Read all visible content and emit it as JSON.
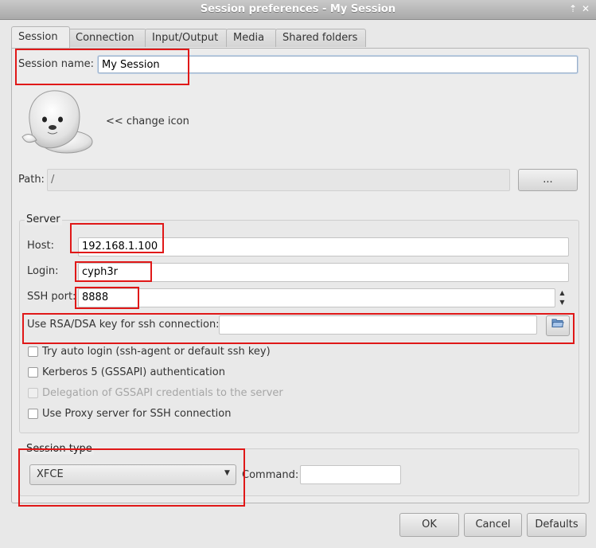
{
  "window": {
    "title": "Session preferences - My Session"
  },
  "tabs": [
    {
      "label": "Session"
    },
    {
      "label": "Connection"
    },
    {
      "label": "Input/Output"
    },
    {
      "label": "Media"
    },
    {
      "label": "Shared folders"
    }
  ],
  "session": {
    "name_label": "Session name:",
    "name_value": "My Session",
    "change_icon_label": "<< change icon",
    "path_label": "Path:",
    "path_value": "/",
    "browse_label": "..."
  },
  "server": {
    "group_title": "Server",
    "host_label": "Host:",
    "host_value": "192.168.1.100",
    "login_label": "Login:",
    "login_value": "cyph3r",
    "port_label": "SSH port:",
    "port_value": "8888",
    "rsa_label": "Use RSA/DSA key for ssh connection:",
    "rsa_value": "",
    "options": [
      {
        "label": "Try auto login (ssh-agent or default ssh key)",
        "checked": false,
        "enabled": true
      },
      {
        "label": "Kerberos 5 (GSSAPI) authentication",
        "checked": false,
        "enabled": true
      },
      {
        "label": "Delegation of GSSAPI credentials to the server",
        "checked": false,
        "enabled": false
      },
      {
        "label": "Use Proxy server for SSH connection",
        "checked": false,
        "enabled": true
      }
    ]
  },
  "session_type": {
    "group_title": "Session type",
    "selected": "XFCE",
    "command_label": "Command:",
    "command_value": ""
  },
  "buttons": {
    "ok": "OK",
    "cancel": "Cancel",
    "defaults": "Defaults"
  },
  "colors": {
    "annotation": "#e01818",
    "titlebar": "#b3b3b3"
  },
  "icons": [
    "seal-mascot-icon",
    "folder-open-icon",
    "close-icon",
    "pin-icon",
    "chevron-down-icon",
    "spin-up-icon",
    "spin-down-icon"
  ]
}
